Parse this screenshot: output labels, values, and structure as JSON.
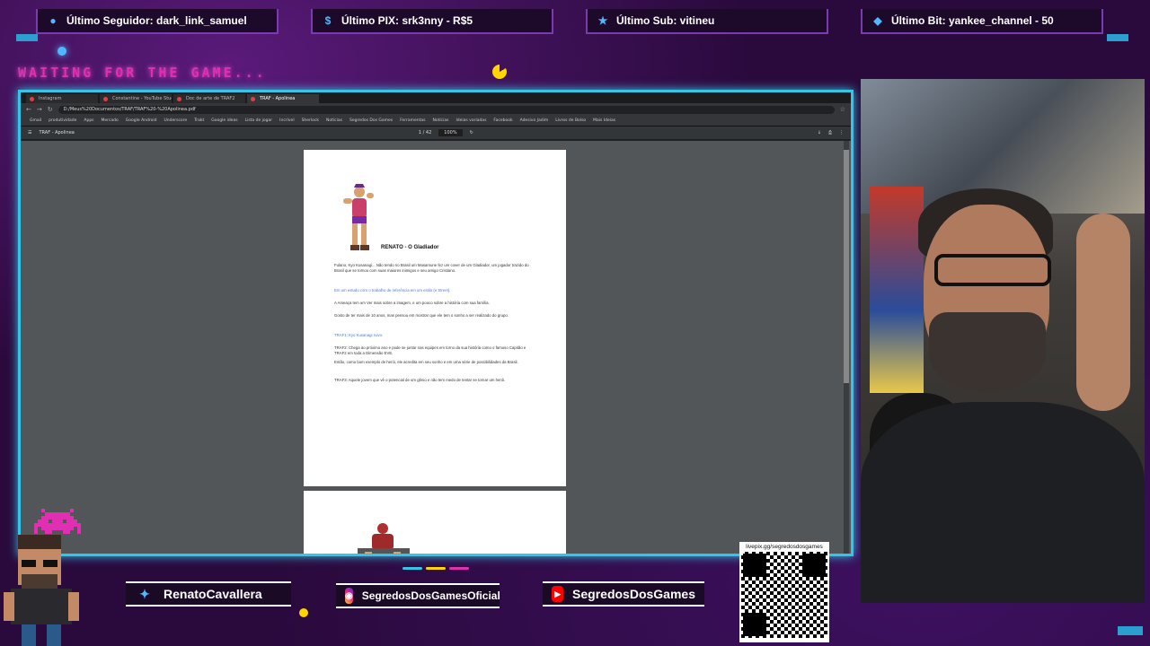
{
  "alerts": {
    "follower": "Último Seguidor: dark_link_samuel",
    "pix": "Último PIX: srk3nny - R$5",
    "sub": "Último Sub: vitineu",
    "bit": "Último Bit: yankee_channel - 50"
  },
  "overlay": {
    "waiting_text": "WAITING FOR THE GAME..."
  },
  "browser": {
    "tabs": [
      "Instagram",
      "Constantine - YouTube Studio",
      "Doc de arte de TRAF2",
      "TRAF - Apolinea"
    ],
    "address": "D:/Meus%20Documentos/TRAF/TRAF%20-%20Apolinea.pdf",
    "pdf_title": "TRAF - Apolinea",
    "pdf_page": "1 / 42",
    "pdf_zoom": "100%",
    "bookmarks": [
      "Gmail",
      "produtividade",
      "Apps",
      "Mercado",
      "Google Android",
      "Underscore",
      "Trakt",
      "Google ideas",
      "Lista de jogar",
      "Incrível",
      "Sherlock",
      "Notícias",
      "Segredos Dos Games",
      "Ferramentas",
      "Notícias",
      "Ideias variadas",
      "Facebook",
      "Adesivo Jadim",
      "Livros de Bolso",
      "Mais Ideias"
    ]
  },
  "document": {
    "heading": "RENATO - O Gladiador",
    "paragraphs": [
      "Fulano, Kyo Kusanagi... Não tendo no Brasil um Masamune fez um cover de um Gladiador, um jogador trazido do Brasil que se tornou com suas maiores inimigos e seu amigo Cristiano.",
      "Em um estudo com o trabalho de referência em um estilo (e Street).",
      "A Ameaça tem um Ver mais sobre a imagem, e um pouco sobre a história com sua família.",
      "Gosto de ter mais de 10 anos, mas pensou em mostrar que ele tem o sonho a ser realizado do grupo.",
      "TRAF1: Kyo Kusanagi ruivo.",
      "TRAF2: Chega ao próximo ano e pode se juntar nas equipes em torno da sua história como o famoso Capitão e TRAF2 em toda a Dimensão EVE.",
      "Então, como bom exemplo de herói, ele acredita em seu sonho e em uma série de possibilidades da Brasil.",
      "TRAF3: Aquele jovem que vê o potencial de um gênio e não tem medo de tentar se tornar um herói."
    ]
  },
  "social": {
    "twitter": "RenatoCavallera",
    "instagram": "SegredosDosGamesOficial",
    "youtube": "SegredosDosGames"
  },
  "qr": {
    "url": "livepix.gg/segredosdosgames"
  },
  "colors": {
    "frame_border": "#34c6e6",
    "waiting": "#e02fb2",
    "alert_border": "#7a3bb0"
  }
}
